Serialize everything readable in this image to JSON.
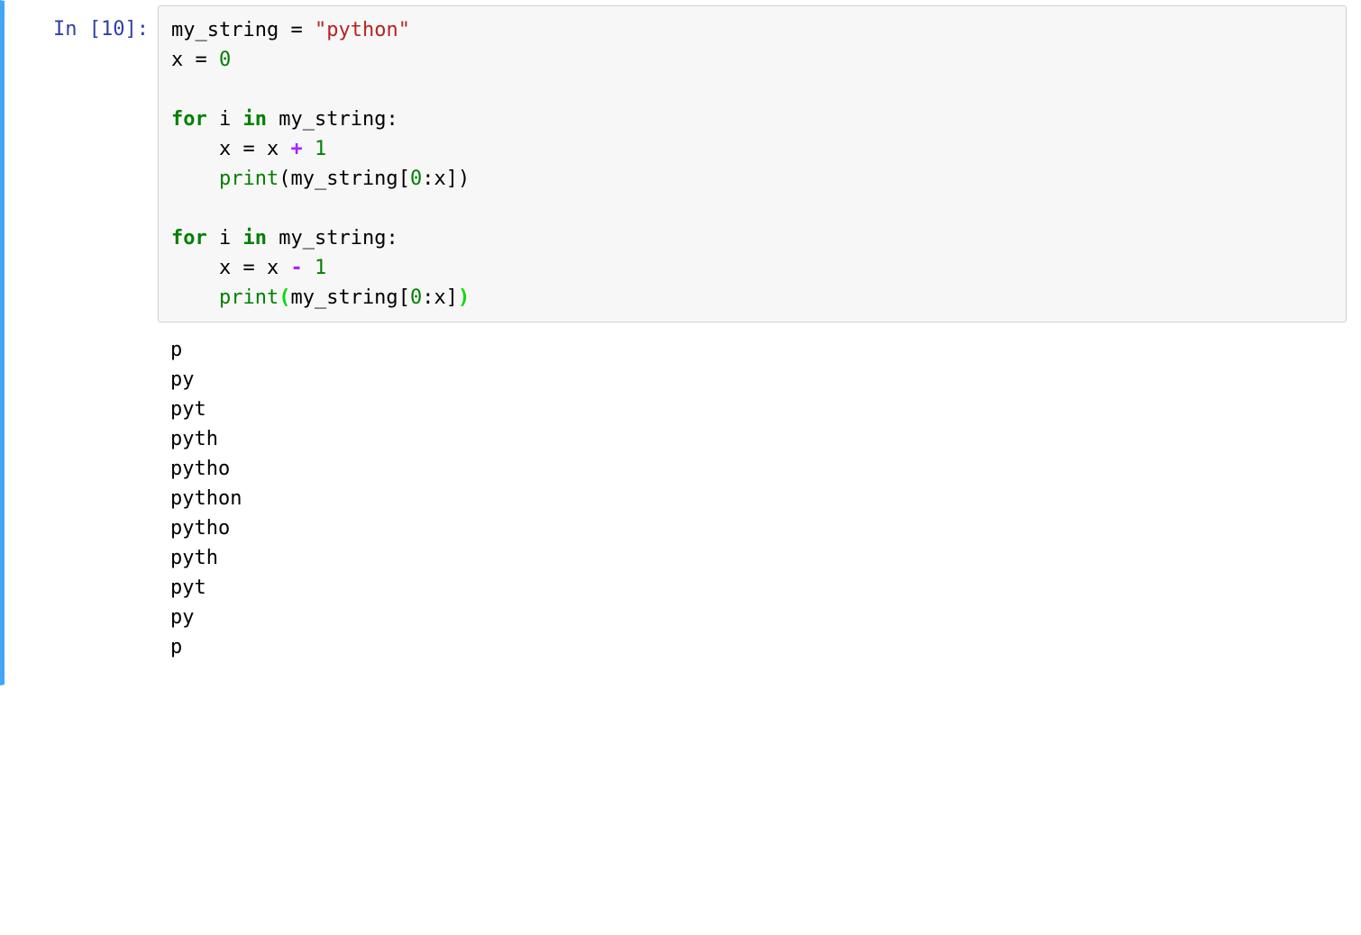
{
  "cell": {
    "prompt_label": "In [10]:",
    "execution_count": 10,
    "code": {
      "line1": {
        "var": "my_string",
        "assign": " = ",
        "quote": "\"",
        "str": "python",
        "quote2": "\""
      },
      "line2": {
        "var": "x",
        "assign": " = ",
        "num": "0"
      },
      "line3": "",
      "line4": {
        "for": "for",
        "sp1": " ",
        "i": "i",
        "sp2": " ",
        "in": "in",
        "sp3": " ",
        "var": "my_string",
        "colon": ":"
      },
      "line5": {
        "indent": "    ",
        "x": "x",
        "eq": " = ",
        "x2": "x",
        "sp": " ",
        "plus": "+",
        "sp2": " ",
        "one": "1"
      },
      "line6": {
        "indent": "    ",
        "print": "print",
        "lp": "(",
        "var": "my_string",
        "lb": "[",
        "zero": "0",
        "colon": ":",
        "x": "x",
        "rb": "]",
        ")": ")"
      },
      "line7": {
        "indent": "    "
      },
      "line8": {
        "for": "for",
        "sp1": " ",
        "i": "i",
        "sp2": " ",
        "in": "in",
        "sp3": " ",
        "var": "my_string",
        "colon": ":"
      },
      "line9": {
        "indent": "    ",
        "x": "x",
        "eq": " = ",
        "x2": "x",
        "sp": " ",
        "minus": "-",
        "sp2": " ",
        "one": "1"
      },
      "line10": {
        "indent": "    ",
        "print": "print",
        "lp": "(",
        "var": "my_string",
        "lb": "[",
        "zero": "0",
        "colon": ":",
        "x": "x",
        "rb": "]",
        ")": ")"
      }
    },
    "output_lines": [
      "p",
      "py",
      "pyt",
      "pyth",
      "pytho",
      "python",
      "pytho",
      "pyth",
      "pyt",
      "py",
      "p",
      ""
    ]
  }
}
